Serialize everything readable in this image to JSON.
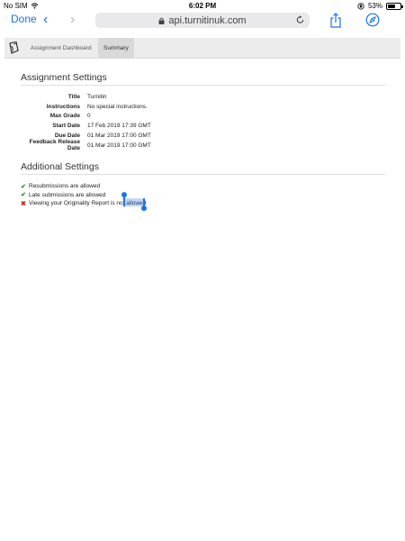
{
  "status_bar": {
    "carrier": "No SIM",
    "time": "6:02 PM",
    "battery_percent": "53%"
  },
  "browser": {
    "done_label": "Done",
    "url": "api.turnitinuk.com"
  },
  "app": {
    "tabs": [
      {
        "label": "Assignment Dashboard",
        "active": false
      },
      {
        "label": "Summary",
        "active": true
      }
    ]
  },
  "assignment_settings": {
    "title": "Assignment Settings",
    "rows": [
      {
        "label": "Title",
        "value": "Turnitin"
      },
      {
        "label": "Instructions",
        "value": "No special instructions."
      },
      {
        "label": "Max Grade",
        "value": "0"
      },
      {
        "label": "Start Date",
        "value": "17 Feb 2019 17:39 GMT"
      },
      {
        "label": "Due Date",
        "value": "01 Mar 2019 17:00 GMT"
      },
      {
        "label": "Feedback Release Date",
        "value": "01 Mar 2019 17:00 GMT"
      }
    ]
  },
  "additional_settings": {
    "title": "Additional Settings",
    "items": [
      {
        "icon": "check-icon",
        "text": "Resubmissions are allowed"
      },
      {
        "icon": "check-icon",
        "text": "Late submissions are allowed"
      },
      {
        "icon": "cross-icon",
        "text": "Viewing your Originality Report is not allowed"
      }
    ]
  },
  "colors": {
    "accent": "#1a73e8",
    "check": "#2e8b3a",
    "cross": "#cc2222"
  }
}
